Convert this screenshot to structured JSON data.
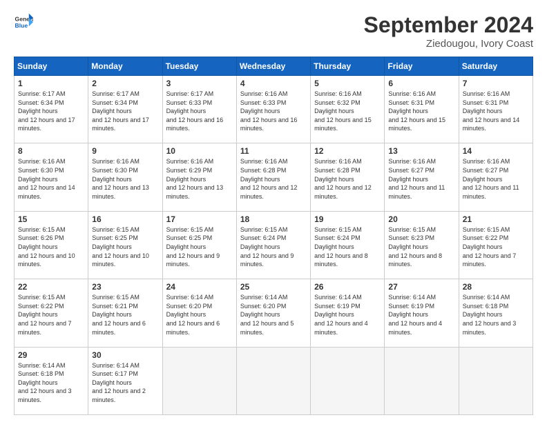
{
  "header": {
    "logo_line1": "General",
    "logo_line2": "Blue",
    "title": "September 2024",
    "subtitle": "Ziedougou, Ivory Coast"
  },
  "weekdays": [
    "Sunday",
    "Monday",
    "Tuesday",
    "Wednesday",
    "Thursday",
    "Friday",
    "Saturday"
  ],
  "weeks": [
    [
      {
        "day": "1",
        "sr": "6:17 AM",
        "ss": "6:34 PM",
        "dl": "12 hours and 17 minutes."
      },
      {
        "day": "2",
        "sr": "6:17 AM",
        "ss": "6:34 PM",
        "dl": "12 hours and 17 minutes."
      },
      {
        "day": "3",
        "sr": "6:17 AM",
        "ss": "6:33 PM",
        "dl": "12 hours and 16 minutes."
      },
      {
        "day": "4",
        "sr": "6:16 AM",
        "ss": "6:33 PM",
        "dl": "12 hours and 16 minutes."
      },
      {
        "day": "5",
        "sr": "6:16 AM",
        "ss": "6:32 PM",
        "dl": "12 hours and 15 minutes."
      },
      {
        "day": "6",
        "sr": "6:16 AM",
        "ss": "6:31 PM",
        "dl": "12 hours and 15 minutes."
      },
      {
        "day": "7",
        "sr": "6:16 AM",
        "ss": "6:31 PM",
        "dl": "12 hours and 14 minutes."
      }
    ],
    [
      {
        "day": "8",
        "sr": "6:16 AM",
        "ss": "6:30 PM",
        "dl": "12 hours and 14 minutes."
      },
      {
        "day": "9",
        "sr": "6:16 AM",
        "ss": "6:30 PM",
        "dl": "12 hours and 13 minutes."
      },
      {
        "day": "10",
        "sr": "6:16 AM",
        "ss": "6:29 PM",
        "dl": "12 hours and 13 minutes."
      },
      {
        "day": "11",
        "sr": "6:16 AM",
        "ss": "6:28 PM",
        "dl": "12 hours and 12 minutes."
      },
      {
        "day": "12",
        "sr": "6:16 AM",
        "ss": "6:28 PM",
        "dl": "12 hours and 12 minutes."
      },
      {
        "day": "13",
        "sr": "6:16 AM",
        "ss": "6:27 PM",
        "dl": "12 hours and 11 minutes."
      },
      {
        "day": "14",
        "sr": "6:16 AM",
        "ss": "6:27 PM",
        "dl": "12 hours and 11 minutes."
      }
    ],
    [
      {
        "day": "15",
        "sr": "6:15 AM",
        "ss": "6:26 PM",
        "dl": "12 hours and 10 minutes."
      },
      {
        "day": "16",
        "sr": "6:15 AM",
        "ss": "6:25 PM",
        "dl": "12 hours and 10 minutes."
      },
      {
        "day": "17",
        "sr": "6:15 AM",
        "ss": "6:25 PM",
        "dl": "12 hours and 9 minutes."
      },
      {
        "day": "18",
        "sr": "6:15 AM",
        "ss": "6:24 PM",
        "dl": "12 hours and 9 minutes."
      },
      {
        "day": "19",
        "sr": "6:15 AM",
        "ss": "6:24 PM",
        "dl": "12 hours and 8 minutes."
      },
      {
        "day": "20",
        "sr": "6:15 AM",
        "ss": "6:23 PM",
        "dl": "12 hours and 8 minutes."
      },
      {
        "day": "21",
        "sr": "6:15 AM",
        "ss": "6:22 PM",
        "dl": "12 hours and 7 minutes."
      }
    ],
    [
      {
        "day": "22",
        "sr": "6:15 AM",
        "ss": "6:22 PM",
        "dl": "12 hours and 7 minutes."
      },
      {
        "day": "23",
        "sr": "6:15 AM",
        "ss": "6:21 PM",
        "dl": "12 hours and 6 minutes."
      },
      {
        "day": "24",
        "sr": "6:14 AM",
        "ss": "6:20 PM",
        "dl": "12 hours and 6 minutes."
      },
      {
        "day": "25",
        "sr": "6:14 AM",
        "ss": "6:20 PM",
        "dl": "12 hours and 5 minutes."
      },
      {
        "day": "26",
        "sr": "6:14 AM",
        "ss": "6:19 PM",
        "dl": "12 hours and 4 minutes."
      },
      {
        "day": "27",
        "sr": "6:14 AM",
        "ss": "6:19 PM",
        "dl": "12 hours and 4 minutes."
      },
      {
        "day": "28",
        "sr": "6:14 AM",
        "ss": "6:18 PM",
        "dl": "12 hours and 3 minutes."
      }
    ],
    [
      {
        "day": "29",
        "sr": "6:14 AM",
        "ss": "6:18 PM",
        "dl": "12 hours and 3 minutes."
      },
      {
        "day": "30",
        "sr": "6:14 AM",
        "ss": "6:17 PM",
        "dl": "12 hours and 2 minutes."
      },
      null,
      null,
      null,
      null,
      null
    ]
  ]
}
